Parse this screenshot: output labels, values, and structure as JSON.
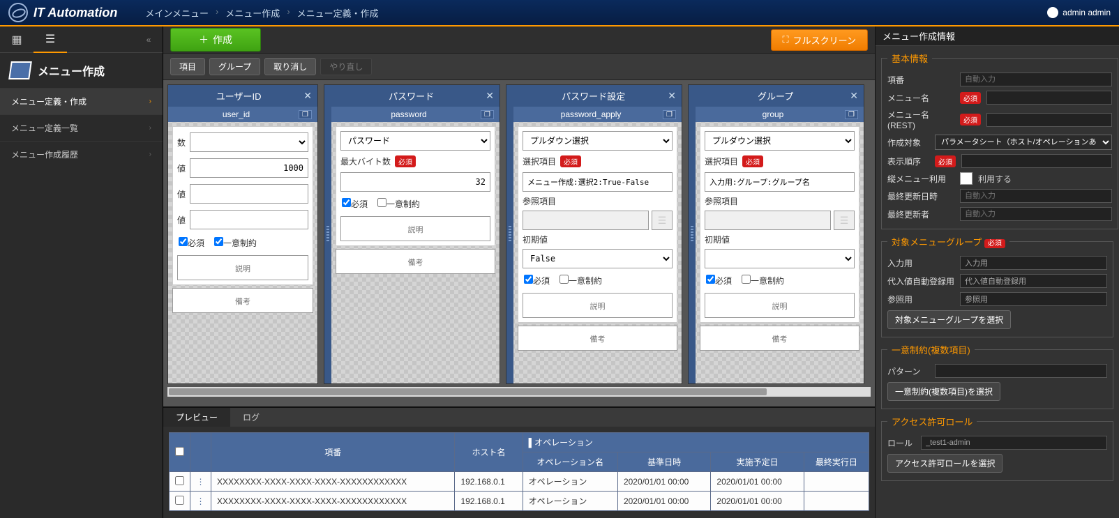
{
  "app": {
    "title": "IT Automation"
  },
  "breadcrumbs": [
    "メインメニュー",
    "メニュー作成",
    "メニュー定義・作成"
  ],
  "user": {
    "name": "admin admin"
  },
  "sidebar": {
    "title": "メニュー作成",
    "items": [
      {
        "label": "メニュー定義・作成",
        "active": true
      },
      {
        "label": "メニュー定義一覧",
        "active": false
      },
      {
        "label": "メニュー作成履歴",
        "active": false
      }
    ]
  },
  "toolbar": {
    "create": "作成",
    "fullscreen": "フルスクリーン",
    "sub": [
      "項目",
      "グループ",
      "取り消し"
    ],
    "sub_disabled": "やり直し"
  },
  "cards": [
    {
      "title": "ユーザーID",
      "field": "user_id",
      "rows": {
        "r1_label": "数",
        "r1_val": "",
        "r2_label": "値",
        "r2_val": "1000",
        "r3_label": "値",
        "r3_val": "",
        "r4_label": "値",
        "r4_val": ""
      },
      "ck_req_label": "必須",
      "ck_uniq_label": "一意制約",
      "desc": "説明",
      "remark": "備考"
    },
    {
      "title": "パスワード",
      "field": "password",
      "type_sel": "パスワード",
      "maxbyte_label": "最大バイト数",
      "maxbyte_val": "32",
      "ck_req_label": "必須",
      "ck_uniq_label": "一意制約",
      "desc": "説明",
      "remark": "備考"
    },
    {
      "title": "パスワード設定",
      "field": "password_apply",
      "type_sel": "プルダウン選択",
      "select_label": "選択項目",
      "select_val": "メニュー作成:選択2:True-False",
      "ref_label": "参照項目",
      "init_label": "初期値",
      "init_val": "False",
      "ck_req_label": "必須",
      "ck_uniq_label": "一意制約",
      "desc": "説明",
      "remark": "備考"
    },
    {
      "title": "グループ",
      "field": "group",
      "type_sel": "プルダウン選択",
      "select_label": "選択項目",
      "select_val": "入力用:グループ:グループ名",
      "ref_label": "参照項目",
      "init_label": "初期値",
      "init_val": "",
      "ck_req_label": "必須",
      "ck_uniq_label": "一意制約",
      "desc": "説明",
      "remark": "備考"
    }
  ],
  "bottom": {
    "tabs": [
      "プレビュー",
      "ログ"
    ],
    "headers": {
      "no": "項番",
      "host": "ホスト名",
      "op_group": "オペレーション",
      "op_name": "オペレーション名",
      "base_dt": "基準日時",
      "sched_dt": "実施予定日",
      "last_dt": "最終実行日"
    },
    "rows": [
      {
        "no": "XXXXXXXX-XXXX-XXXX-XXXX-XXXXXXXXXXXX",
        "host": "192.168.0.1",
        "op": "オペレーション",
        "base": "2020/01/01 00:00",
        "sched": "2020/01/01 00:00"
      },
      {
        "no": "XXXXXXXX-XXXX-XXXX-XXXX-XXXXXXXXXXXX",
        "host": "192.168.0.1",
        "op": "オペレーション",
        "base": "2020/01/01 00:00",
        "sched": "2020/01/01 00:00"
      }
    ]
  },
  "panel": {
    "title": "メニュー作成情報",
    "basic": {
      "legend": "基本情報",
      "l_no": "項番",
      "v_no": "自動入力",
      "l_name": "メニュー名",
      "req": "必須",
      "l_rest": "メニュー名(REST)",
      "l_target": "作成対象",
      "v_target": "パラメータシート（ホスト/オペレーションあ",
      "l_order": "表示順序",
      "l_vert": "縦メニュー利用",
      "l_use": "利用する",
      "l_upd_dt": "最終更新日時",
      "v_upd_dt": "自動入力",
      "l_upd_by": "最終更新者",
      "v_upd_by": "自動入力"
    },
    "group": {
      "legend": "対象メニューグループ",
      "l_input": "入力用",
      "v_input": "入力用",
      "l_sub": "代入値自動登録用",
      "v_sub": "代入値自動登録用",
      "l_ref": "参照用",
      "v_ref": "参照用",
      "btn": "対象メニューグループを選択"
    },
    "unique": {
      "legend": "一意制約(複数項目)",
      "l_pattern": "パターン",
      "btn": "一意制約(複数項目)を選択"
    },
    "role": {
      "legend": "アクセス許可ロール",
      "l_role": "ロール",
      "v_role": "_test1-admin",
      "btn": "アクセス許可ロールを選択"
    }
  }
}
